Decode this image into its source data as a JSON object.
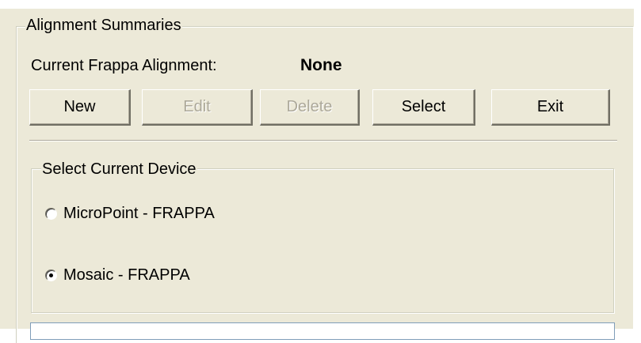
{
  "alignment_summaries": {
    "title": "Alignment Summaries",
    "current_label": "Current Frappa Alignment:",
    "current_value": "None",
    "buttons": {
      "new": {
        "label": "New",
        "enabled": true
      },
      "edit": {
        "label": "Edit",
        "enabled": false
      },
      "delete": {
        "label": "Delete",
        "enabled": false
      },
      "select": {
        "label": "Select",
        "enabled": true
      },
      "exit": {
        "label": "Exit",
        "enabled": true
      }
    }
  },
  "device_select": {
    "title": "Select Current Device",
    "options": [
      {
        "label": "MicroPoint - FRAPPA",
        "checked": false
      },
      {
        "label": "Mosaic - FRAPPA",
        "checked": true
      }
    ]
  },
  "colors": {
    "panel_background": "#ece9d8",
    "disabled_text": "#aca899"
  }
}
